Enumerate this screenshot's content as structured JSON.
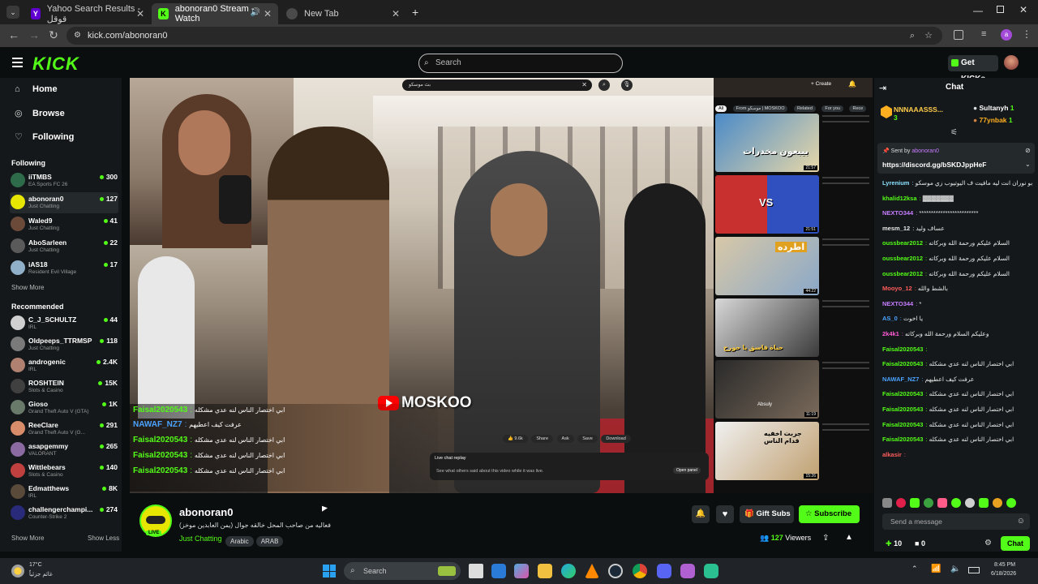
{
  "browser": {
    "tabs": [
      {
        "label": "Yahoo Search Results - قوقل"
      },
      {
        "label": "abonoran0 Stream - Watch"
      },
      {
        "label": "New Tab"
      }
    ],
    "url": "kick.com/abonoran0"
  },
  "kick": {
    "logo": "KICK",
    "search_placeholder": "Search",
    "get_kicks": "Get KICKs"
  },
  "sidebar": {
    "nav": [
      {
        "label": "Home"
      },
      {
        "label": "Browse"
      },
      {
        "label": "Following"
      }
    ],
    "following_header": "Following",
    "following": [
      {
        "name": "iiTMBS",
        "category": "EA Sports FC 26",
        "viewers": "300"
      },
      {
        "name": "abonoran0",
        "category": "Just Chatting",
        "viewers": "127"
      },
      {
        "name": "Waled9",
        "category": "Just Chatting",
        "viewers": "41"
      },
      {
        "name": "AboSarleen",
        "category": "Just Chatting",
        "viewers": "22"
      },
      {
        "name": "iAS18",
        "category": "Resident Evil Village",
        "viewers": "17"
      }
    ],
    "show_more_1": "Show More",
    "recommended_header": "Recommended",
    "recommended": [
      {
        "name": "C_J_SCHULTZ",
        "category": "IRL",
        "viewers": "44"
      },
      {
        "name": "Oldpeeps_TTRMSP",
        "category": "Just Chatting",
        "viewers": "118"
      },
      {
        "name": "androgenic",
        "category": "IRL",
        "viewers": "2.4K"
      },
      {
        "name": "ROSHTEIN",
        "category": "Slots & Casino",
        "viewers": "15K"
      },
      {
        "name": "Gioso",
        "category": "Grand Theft Auto V (GTA)",
        "viewers": "1K"
      },
      {
        "name": "ReeClare",
        "category": "Grand Theft Auto V (G...",
        "viewers": "291"
      },
      {
        "name": "asapgemmy",
        "category": "VALORANT",
        "viewers": "265"
      },
      {
        "name": "Wittlebears",
        "category": "Slots & Casino",
        "viewers": "140"
      },
      {
        "name": "Edmatthews",
        "category": "IRL",
        "viewers": "8K"
      },
      {
        "name": "challengerchampi...",
        "category": "Counter-Strike 2",
        "viewers": "274"
      }
    ],
    "show_more_2": "Show More",
    "show_less": "Show Less"
  },
  "video": {
    "yt_search": "بث موسكو",
    "yt_create": "Create",
    "yt_chips": [
      "All",
      "From موسكو | MOSKOO",
      "Related",
      "For you",
      "Rece"
    ],
    "watermark": "MOSKOO",
    "yt_actions": [
      "9.6k",
      "Share",
      "Ask",
      "Save",
      "Download"
    ],
    "live_replay_title": "Live chat replay",
    "live_replay_sub": "See what others said about this video while it was live.",
    "open_panel": "Open panel",
    "thumb_texts": [
      "بيبعون مخدرات",
      "VS",
      "اطرده",
      "حياة فاسق يا حورج",
      "Absuly",
      "جربت اخفيه قدام الناس"
    ],
    "thumb_durations": [
      "21:57",
      "21:51",
      "44:22",
      "",
      "11:19",
      "15:26"
    ],
    "overlay_chat": [
      {
        "user": "Faisal2020543",
        "text": "ابي اختصار الناس لنه عدي مشكله"
      },
      {
        "user": "NAWAF_NZ7",
        "text": "عرفت كيف اعطيهم"
      },
      {
        "user": "Faisal2020543",
        "text": "ابي اختصار الناس لنه عدي مشكله"
      },
      {
        "user": "Faisal2020543",
        "text": "ابي اختصار الناس لنه عدي مشكله"
      },
      {
        "user": "Faisal2020543",
        "text": "ابي اختصار الناس لنه عدي مشكله"
      }
    ]
  },
  "stream": {
    "streamer": "abonoran0",
    "title": "فعاليه من صاحب المحل خالقه جوال (يمن العابدين موخز)",
    "category": "Just Chatting",
    "tags": [
      "Arabic",
      "ARAB"
    ],
    "live_badge": "LIVE",
    "gift_subs": "Gift Subs",
    "subscribe": "Subscribe",
    "viewers": "127",
    "viewers_label": "Viewers"
  },
  "chat": {
    "title": "Chat",
    "top_gifters": [
      {
        "name": "NNNAAASSS...",
        "count": "3"
      },
      {
        "name": "Sultanyh",
        "count": "1"
      },
      {
        "name": "77ynbak",
        "count": "1"
      }
    ],
    "pinned_by_label": "Sent by",
    "pinned_by": "abonoran0",
    "pinned_link": "https://discord.gg/bSKDJppHeF",
    "messages": [
      {
        "user": "Lyrenium",
        "text": "ابو نوران انت ليه مافيت ف اليوتيوب زي موسكو",
        "color": "#8be0ff"
      },
      {
        "user": "khalid12ksa",
        "text": "▓▓▓▓▓▓▓",
        "color": "#53fc18"
      },
      {
        "user": "NEXTO344",
        "text": "*************************",
        "color": "#c77dff"
      },
      {
        "user": "mesm_12",
        "text": "عساف وليد",
        "color": "#e8e8e8"
      },
      {
        "user": "oussbear2012",
        "text": "السلام عليكم ورحمة الله وبركاته",
        "color": "#53fc18"
      },
      {
        "user": "oussbear2012",
        "text": "السلام عليكم ورحمة الله وبركاته",
        "color": "#53fc18"
      },
      {
        "user": "oussbear2012",
        "text": "السلام عليكم ورحمة الله وبركاته",
        "color": "#53fc18"
      },
      {
        "user": "Mooyo_12",
        "text": "بالشط والله",
        "color": "#ff5c5c"
      },
      {
        "user": "NEXTO344",
        "text": "*",
        "color": "#c77dff"
      },
      {
        "user": "AS_0",
        "text": "يا اخوت",
        "color": "#4aa3ff"
      },
      {
        "user": "2k4k1",
        "text": "وعليكم السلام ورحمة الله وبركاته",
        "color": "#ff5cd6"
      },
      {
        "user": "Faisal2020543",
        "text": "",
        "color": "#53fc18"
      },
      {
        "user": "Faisal2020543",
        "text": "ابي اختصار الناس لنه عدي مشكله",
        "color": "#53fc18"
      },
      {
        "user": "NAWAF_NZ7",
        "text": "عرفت كيف اعطيهم",
        "color": "#4aa3ff"
      },
      {
        "user": "Faisal2020543",
        "text": "ابي اختصار الناس لنه عدي مشكله",
        "color": "#53fc18"
      },
      {
        "user": "Faisal2020543",
        "text": "ابي اختصار الناس لنه عدي مشكله",
        "color": "#53fc18"
      },
      {
        "user": "Faisal2020543",
        "text": "ابي اختصار الناس لنه عدي مشكله",
        "color": "#53fc18"
      },
      {
        "user": "Faisal2020543",
        "text": "ابي اختصار الناس لنه عدي مشكله",
        "color": "#53fc18"
      },
      {
        "user": "alkasir",
        "text": "",
        "color": "#ff5c5c"
      }
    ],
    "input_placeholder": "Send a message",
    "kicks_count": "10",
    "zero_count": "0",
    "chat_button": "Chat"
  },
  "taskbar": {
    "weather_temp": "17°C",
    "weather_desc": "غائم جزئياً",
    "search_placeholder": "Search",
    "time": "8:45 PM",
    "date": "6/18/2026"
  },
  "colors": {
    "accent": "#53fc18",
    "bg": "#0b0e0f",
    "panel": "#14181a"
  }
}
